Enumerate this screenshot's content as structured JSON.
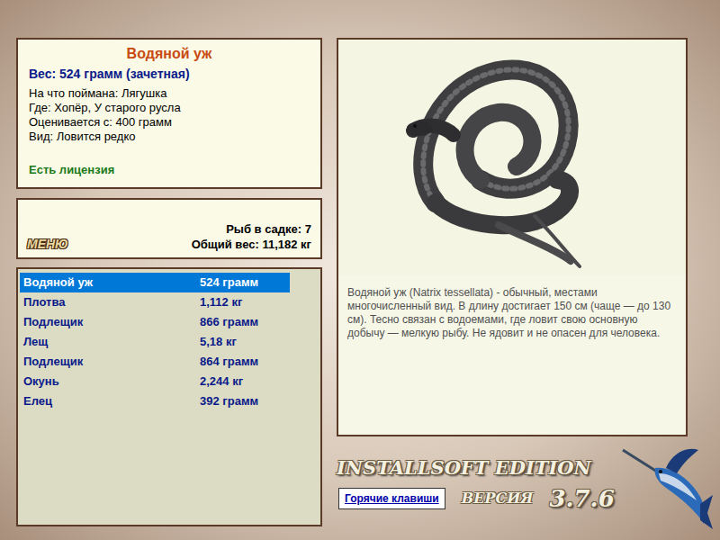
{
  "catch": {
    "name": "Водяной уж",
    "weight": "Вес: 524 грамм (зачетная)",
    "details": [
      "На что поймана: Лягушка",
      "Где: Хопёр, У старого русла",
      "Оценивается с: 400 грамм",
      "Вид: Ловится редко"
    ],
    "license": "Есть лицензия"
  },
  "menu_button": "МЕНЮ",
  "keepnet": {
    "count": "Рыб в садке: 7",
    "total": "Общий вес: 11,182 кг"
  },
  "fish_list": [
    {
      "name": "Водяной уж",
      "weight": "524 грамм",
      "selected": true
    },
    {
      "name": "Плотва",
      "weight": "1,112 кг",
      "selected": false
    },
    {
      "name": "Подлещик",
      "weight": "866 грамм",
      "selected": false
    },
    {
      "name": "Лещ",
      "weight": "5,18 кг",
      "selected": false
    },
    {
      "name": "Подлещик",
      "weight": "864 грамм",
      "selected": false
    },
    {
      "name": "Окунь",
      "weight": "2,244 кг",
      "selected": false
    },
    {
      "name": "Елец",
      "weight": "392 грамм",
      "selected": false
    }
  ],
  "description": "Водяной уж (Natrix tessellata) - обычный, местами многочисленный вид. В длину достигает 150 см (чаще — до 130 см). Тесно связан с водоемами, где ловит свою основную добычу — мелкую рыбу. Не ядовит и не опасен для человека.",
  "logo": "INSTALLSOFT EDITION",
  "version_label": "ВЕРСИЯ",
  "version": "3.7.6",
  "hotkeys_button": "Горячие клавиши"
}
